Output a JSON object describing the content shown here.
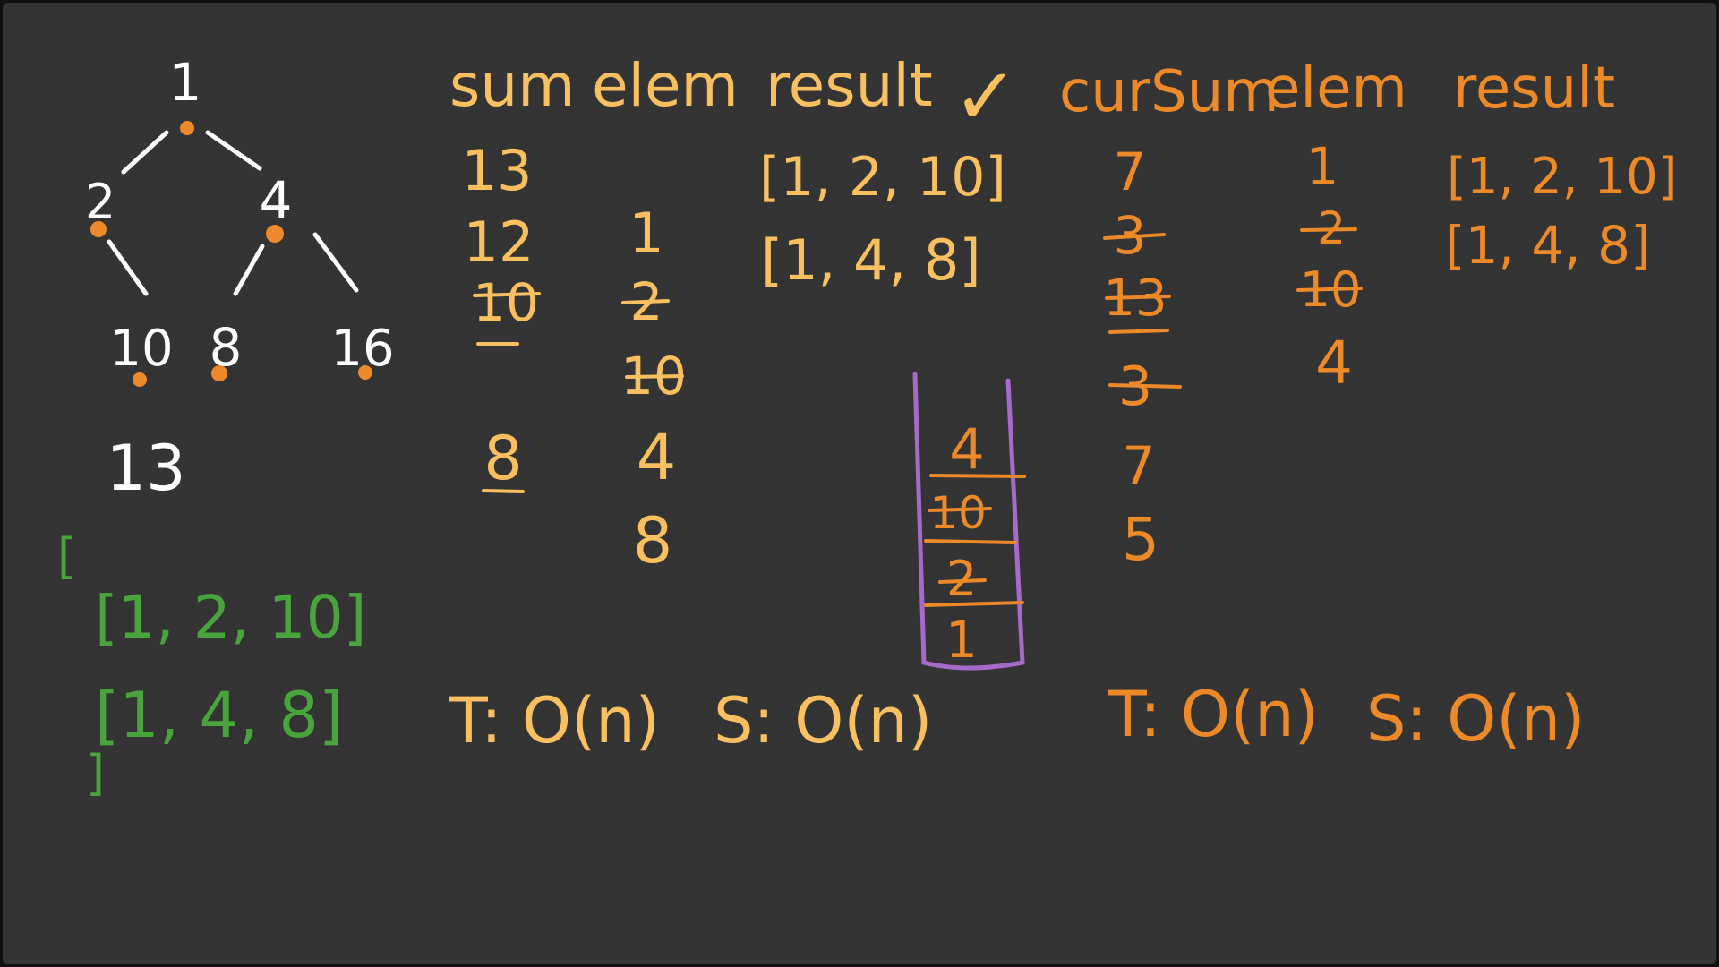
{
  "colors": {
    "board": "#343434",
    "frame": "#111111",
    "white": "#ffffff",
    "yellow": "#f8c060",
    "orange": "#ec8a2a",
    "green": "#4aa43e",
    "purple": "#a66ac8"
  },
  "tree": {
    "root": "1",
    "left_child": "2",
    "right_child": "4",
    "leaf_left": "10",
    "leaf_middle": "8",
    "leaf_right": "16",
    "target": "13"
  },
  "answer": {
    "open": "[",
    "path_1": "[1, 2, 10]",
    "path_2": "[1, 4, 8]",
    "close": "]"
  },
  "table1": {
    "headers": [
      "sum",
      "elem",
      "result"
    ],
    "checkmark": "✓",
    "sum_values": [
      "13",
      "12",
      "10",
      "8"
    ],
    "elem_values": [
      "1",
      "2",
      "10",
      "4",
      "8"
    ],
    "result_values": [
      "[1, 2, 10]",
      "[1, 4, 8]"
    ],
    "complexity_time": "T: O(n)",
    "complexity_space": "S: O(n)"
  },
  "stack": {
    "items": [
      "4",
      "10",
      "2",
      "1"
    ]
  },
  "table2": {
    "headers": [
      "curSum",
      "elem",
      "result"
    ],
    "cursum_values": [
      "7",
      "3",
      "13",
      "3",
      "7",
      "5"
    ],
    "elem_values": [
      "1",
      "2",
      "10",
      "4"
    ],
    "result_values": [
      "[1, 2, 10]",
      "[1, 4, 8]"
    ],
    "complexity_time": "T: O(n)",
    "complexity_space": "S: O(n)"
  }
}
